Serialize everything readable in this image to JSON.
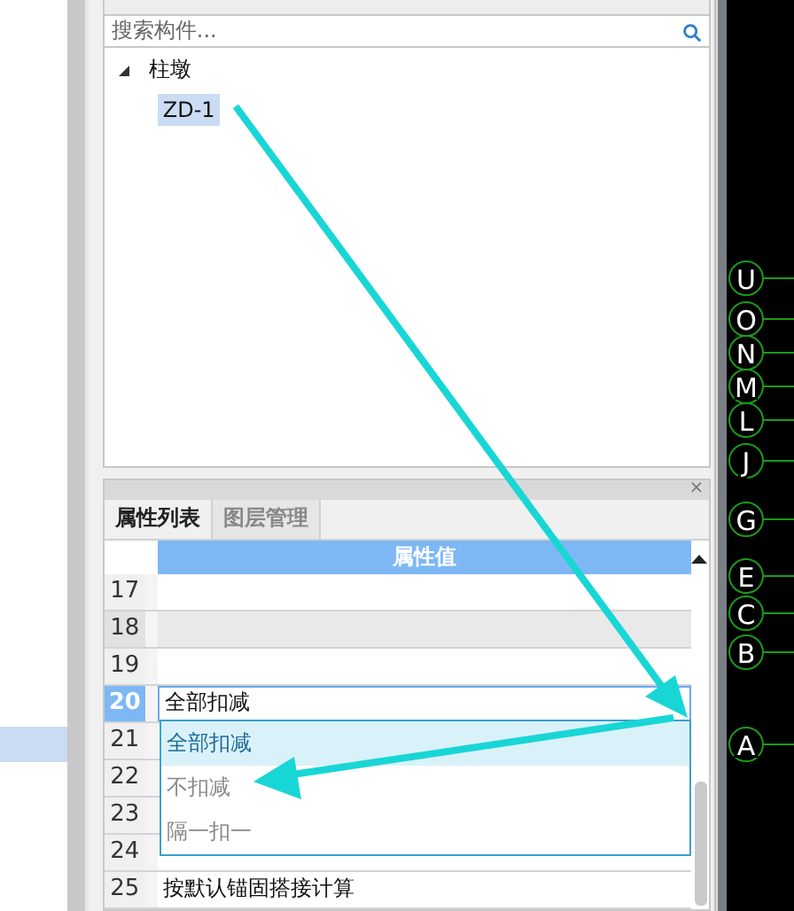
{
  "search": {
    "placeholder": "搜索构件..."
  },
  "tree": [
    {
      "label": "柱墩",
      "expanded": true,
      "children": [
        {
          "label": "ZD-1",
          "selected": true
        }
      ]
    }
  ],
  "left_list": [
    {
      "selected": true
    }
  ],
  "properties_panel": {
    "close": "×",
    "tabs": [
      {
        "label": "属性列表",
        "selected": true
      },
      {
        "label": "图层管理",
        "selected": false
      }
    ],
    "columns": [
      "属性值"
    ],
    "rows": [
      {
        "number": "17",
        "value": "",
        "selected": false,
        "shaded": false
      },
      {
        "number": "18",
        "value": "",
        "selected": false,
        "shaded": true
      },
      {
        "number": "19",
        "value": "",
        "selected": false,
        "shaded": false
      },
      {
        "number": "20",
        "value": "全部扣减",
        "selected": true,
        "shaded": false
      },
      {
        "number": "21",
        "value": "",
        "selected": false,
        "shaded": false
      },
      {
        "number": "22",
        "value": "",
        "selected": false,
        "shaded": false
      },
      {
        "number": "23",
        "value": "",
        "selected": false,
        "shaded": false
      },
      {
        "number": "24",
        "value": "",
        "selected": false,
        "shaded": false
      },
      {
        "number": "25",
        "value": "按默认锚固搭接计算",
        "selected": false,
        "shaded": false
      }
    ],
    "dropdown": {
      "options": [
        {
          "label": "全部扣减",
          "selected": true
        },
        {
          "label": "不扣减",
          "selected": false
        },
        {
          "label": "隔一扣一",
          "selected": false
        }
      ]
    }
  },
  "axis_labels": [
    {
      "label": "U"
    },
    {
      "label": "O"
    },
    {
      "label": "N"
    },
    {
      "label": "M"
    },
    {
      "label": "L"
    },
    {
      "label": "J"
    },
    {
      "label": "G"
    },
    {
      "label": "E"
    },
    {
      "label": "C"
    },
    {
      "label": "B"
    },
    {
      "label": "A"
    }
  ]
}
